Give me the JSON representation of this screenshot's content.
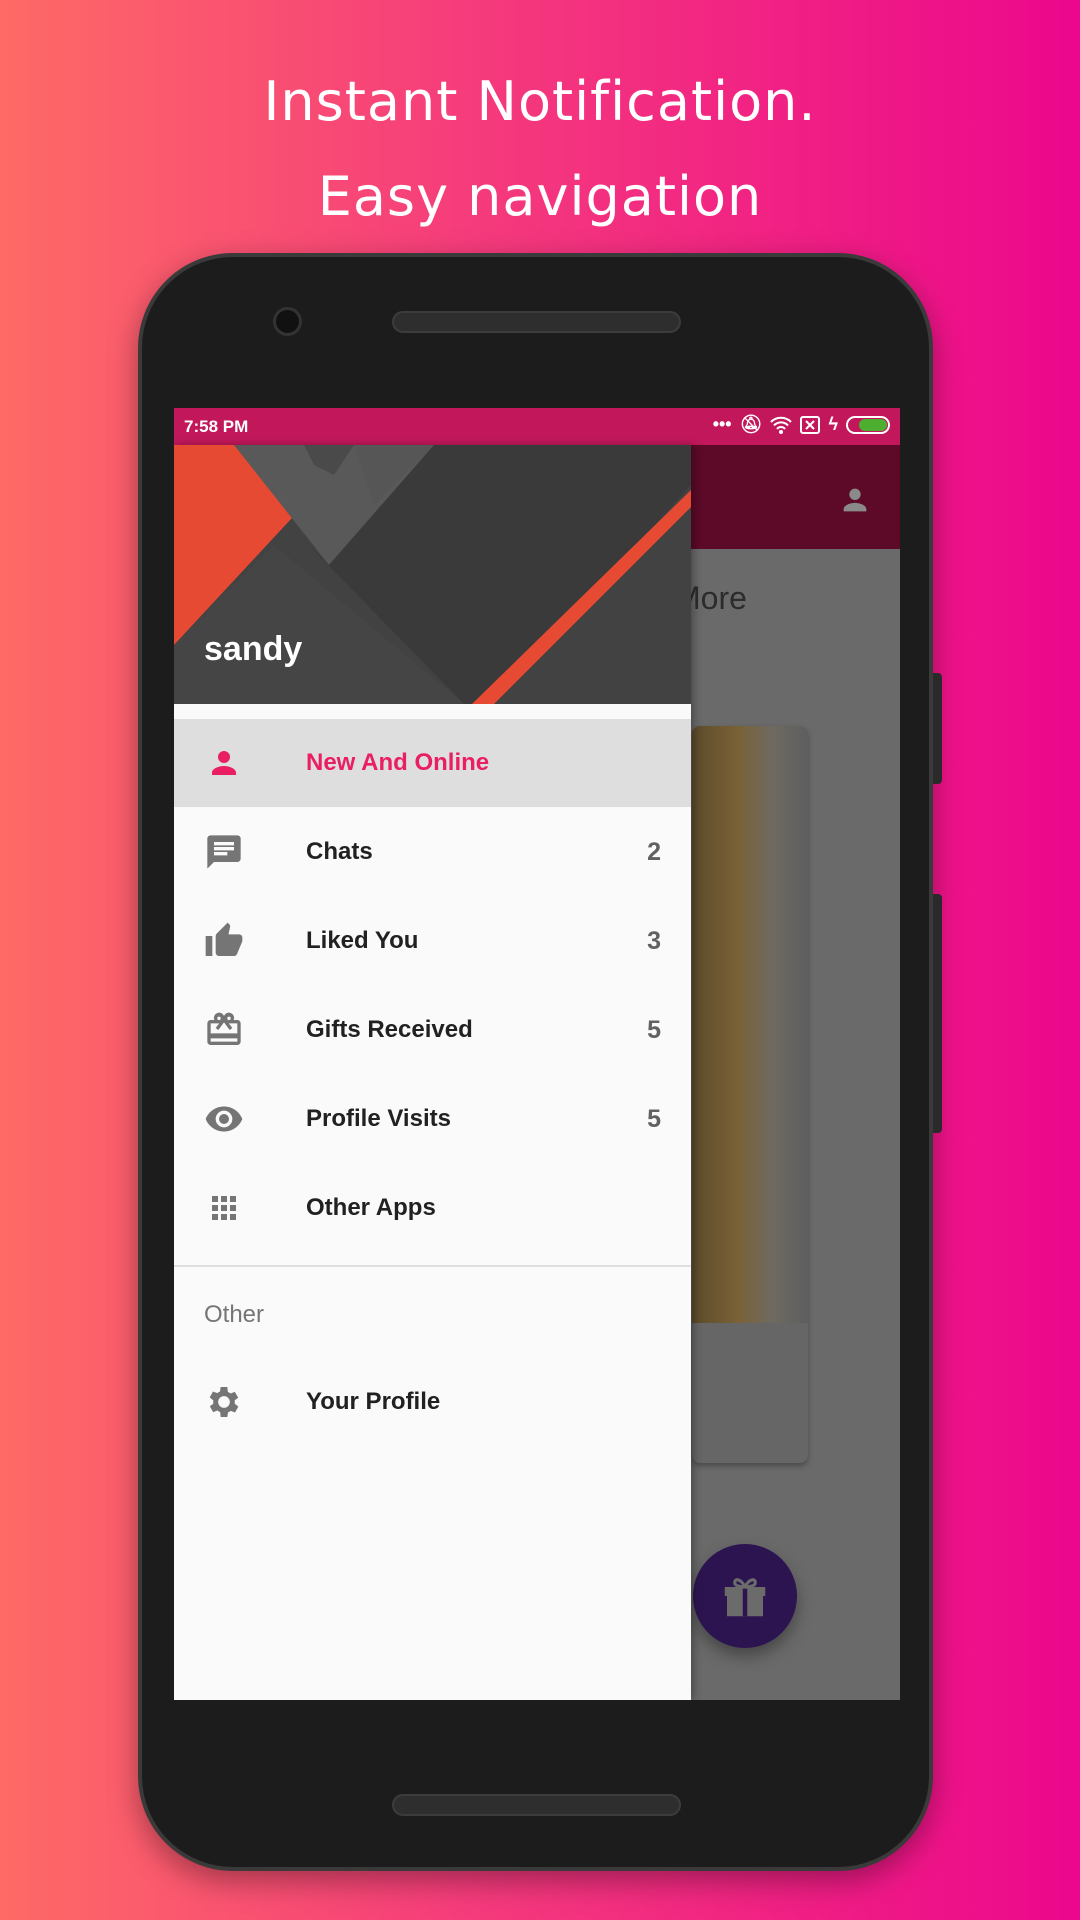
{
  "headline": {
    "line1": "Instant Notification.",
    "line2": "Easy navigation"
  },
  "status_bar": {
    "time": "7:58 PM",
    "icons": [
      "more-dots-icon",
      "bell-off-icon",
      "wifi-icon",
      "sim-x-icon",
      "charging-icon",
      "battery-icon"
    ]
  },
  "drawer": {
    "user_name": "sandy",
    "items": [
      {
        "label": "New And Online",
        "count": "",
        "icon": "person-icon",
        "active": true
      },
      {
        "label": "Chats",
        "count": "2",
        "icon": "chat-icon"
      },
      {
        "label": "Liked You",
        "count": "3",
        "icon": "thumb-up-icon"
      },
      {
        "label": "Gifts Received",
        "count": "5",
        "icon": "gift-card-icon"
      },
      {
        "label": "Profile Visits",
        "count": "5",
        "icon": "eye-icon"
      },
      {
        "label": "Other Apps",
        "count": "",
        "icon": "apps-grid-icon"
      }
    ],
    "section_label": "Other",
    "other_items": [
      {
        "label": "Your Profile",
        "icon": "gear-icon"
      }
    ]
  },
  "background_content": {
    "partial_text": "More"
  },
  "colors": {
    "accent": "#e91e63",
    "status_bar": "#c2185b",
    "toolbar": "#5c0a28",
    "fab": "#2c1450",
    "header_orange": "#e64a33"
  }
}
